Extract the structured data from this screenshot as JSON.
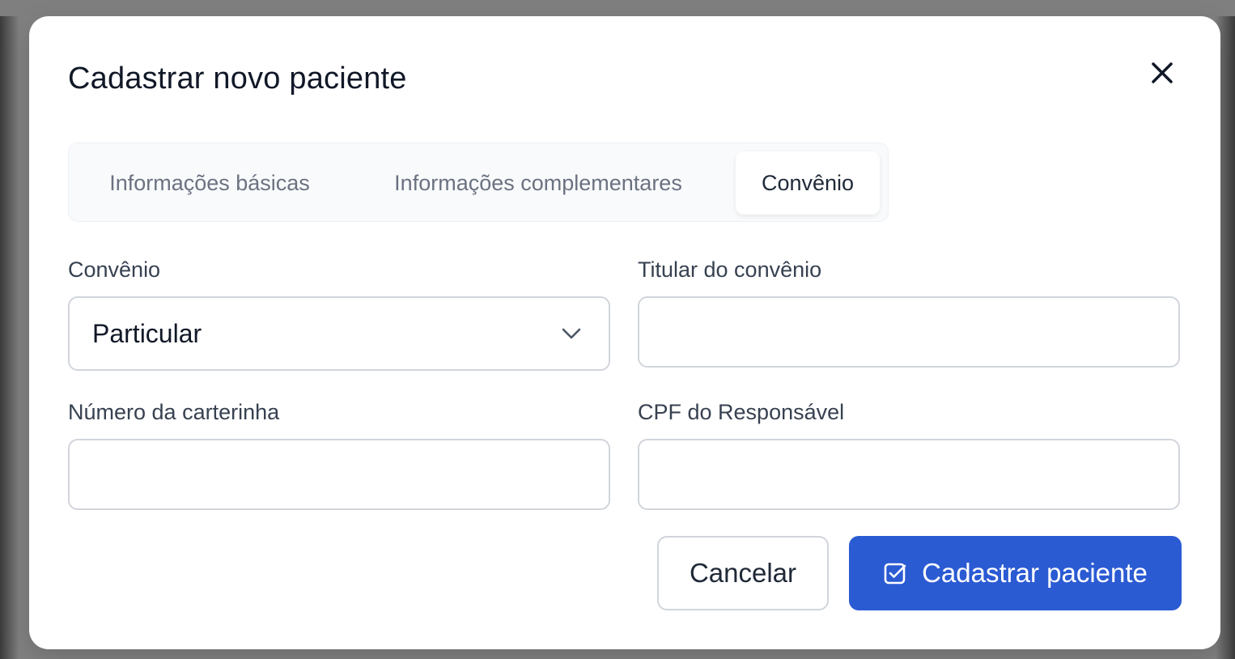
{
  "modal": {
    "title": "Cadastrar novo paciente",
    "close_icon": "close-icon"
  },
  "tabs": [
    {
      "label": "Informações básicas",
      "active": false
    },
    {
      "label": "Informações complementares",
      "active": false
    },
    {
      "label": "Convênio",
      "active": true
    }
  ],
  "form": {
    "convenio": {
      "label": "Convênio",
      "value": "Particular",
      "icon": "chevron-down-icon"
    },
    "titular": {
      "label": "Titular do convênio",
      "value": ""
    },
    "carterinha": {
      "label": "Número da carterinha",
      "value": ""
    },
    "cpf_responsavel": {
      "label": "CPF do Responsável",
      "value": ""
    }
  },
  "actions": {
    "cancel_label": "Cancelar",
    "submit_label": "Cadastrar paciente",
    "submit_icon": "checkbox-check-icon"
  },
  "colors": {
    "primary": "#2b5bd3",
    "text": "#111827",
    "muted": "#6b7280",
    "border": "#d1d5db",
    "overlay": "#808080"
  }
}
